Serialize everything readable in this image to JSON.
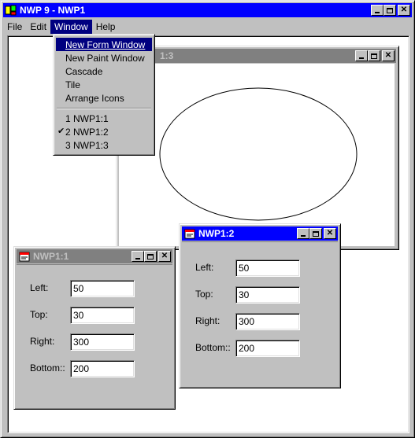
{
  "app": {
    "title": "NWP 9 - NWP1"
  },
  "menubar": {
    "items": [
      {
        "label": "File"
      },
      {
        "label": "Edit"
      },
      {
        "label": "Window"
      },
      {
        "label": "Help"
      }
    ],
    "open_menu": "Window"
  },
  "window_menu": {
    "items": [
      {
        "label": "New Form Window",
        "highlighted": true
      },
      {
        "label": "New Paint Window"
      },
      {
        "label": "Cascade"
      },
      {
        "label": "Tile"
      },
      {
        "label": "Arrange Icons"
      }
    ],
    "windows": [
      {
        "label": "1 NWP1:1",
        "checked": false
      },
      {
        "label": "2 NWP1:2",
        "checked": true
      },
      {
        "label": "3 NWP1:3",
        "checked": false
      }
    ]
  },
  "paint_window": {
    "title": "NWP1:3",
    "title_visible_fragment": "1:3"
  },
  "form_window_1": {
    "title": "NWP1:1",
    "fields": [
      {
        "label": "Left:",
        "value": "50"
      },
      {
        "label": "Top:",
        "value": "30"
      },
      {
        "label": "Right:",
        "value": "300"
      },
      {
        "label": "Bottom::",
        "value": "200"
      }
    ]
  },
  "form_window_2": {
    "title": "NWP1:2",
    "fields": [
      {
        "label": "Left:",
        "value": "50"
      },
      {
        "label": "Top:",
        "value": "30"
      },
      {
        "label": "Right:",
        "value": "300"
      },
      {
        "label": "Bottom::",
        "value": "200"
      }
    ]
  },
  "colors": {
    "active_title": "#0000ff",
    "inactive_title": "#808080",
    "face": "#c0c0c0",
    "menu_highlight": "#000080"
  },
  "icons": {
    "app": "app-icon",
    "doc": "document-icon",
    "check": "check-icon"
  }
}
